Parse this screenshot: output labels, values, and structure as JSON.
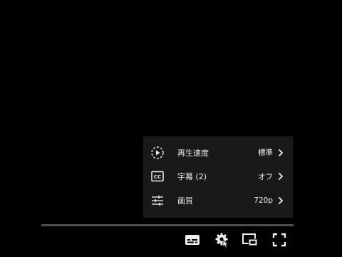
{
  "settings_menu": {
    "items": [
      {
        "icon": "playback-speed-icon",
        "label": "再生速度",
        "value": "標準"
      },
      {
        "icon": "subtitles-cc-icon",
        "label": "字幕 (2)",
        "value": "オフ"
      },
      {
        "icon": "sliders-icon",
        "label": "画質",
        "value": "720p"
      }
    ]
  },
  "progress": {
    "played_fraction": 0
  },
  "controls": {
    "buttons": [
      "subtitles-icon",
      "settings-gear-icon",
      "miniplayer-icon",
      "fullscreen-icon"
    ]
  },
  "colors": {
    "menu_bg": "#1c1c1c",
    "text": "#eeeeee",
    "progress_played": "#ff0000"
  }
}
